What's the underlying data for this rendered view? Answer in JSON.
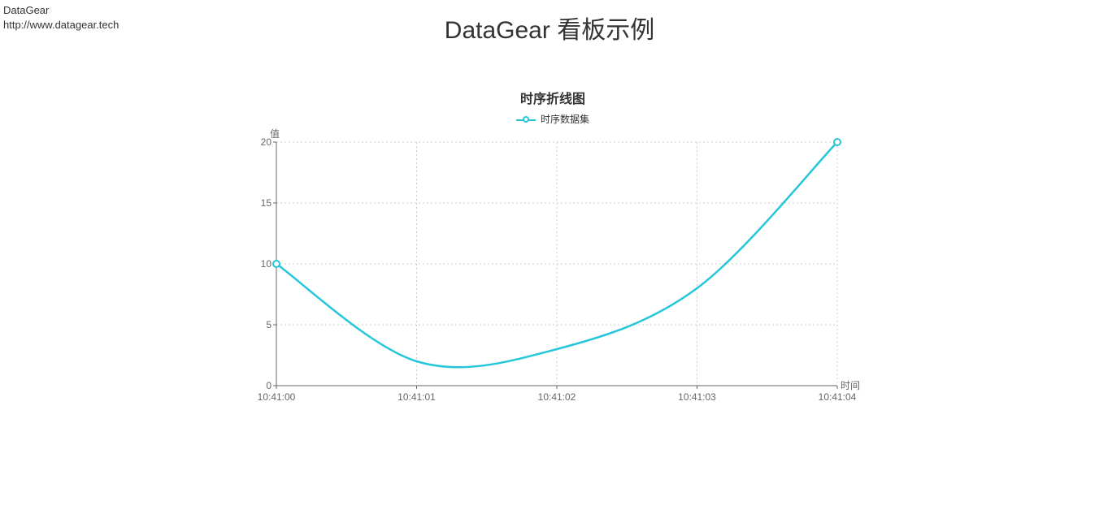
{
  "header": {
    "brand": "DataGear",
    "url": "http://www.datagear.tech",
    "page_title": "DataGear 看板示例"
  },
  "chart": {
    "title": "时序折线图",
    "legend_label": "时序数据集",
    "xlabel": "时间",
    "ylabel": "值",
    "line_color": "#26c6da"
  },
  "chart_data": {
    "type": "line",
    "title": "时序折线图",
    "xlabel": "时间",
    "ylabel": "值",
    "categories": [
      "10:41:00",
      "10:41:01",
      "10:41:02",
      "10:41:03",
      "10:41:04"
    ],
    "series": [
      {
        "name": "时序数据集",
        "values": [
          10,
          2,
          3,
          8,
          20
        ]
      }
    ],
    "ylim": [
      0,
      20
    ],
    "y_ticks": [
      0,
      5,
      10,
      15,
      20
    ],
    "grid": true,
    "legend_position": "top"
  }
}
